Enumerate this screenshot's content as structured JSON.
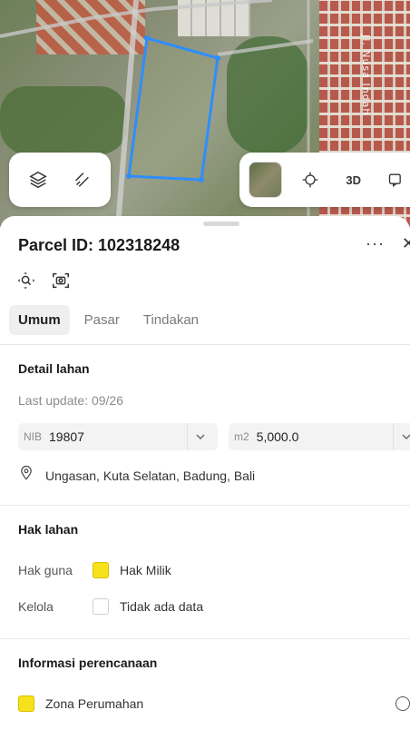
{
  "map": {
    "street_label": "Jl. Nusa Indah",
    "btn_3d_label": "3D",
    "icons": {
      "layers": "layers-icon",
      "draw": "draw-tool-icon",
      "basemap": "basemap-thumbnail",
      "locate": "locate-crosshair-icon",
      "compare": "compare-icon"
    },
    "parcel_color": "#2f8dff"
  },
  "panel": {
    "title": "Parcel ID: 102318248",
    "more": "···",
    "close": "✕",
    "tools": [
      "zoom-to-parcel-icon",
      "screenshot-icon"
    ]
  },
  "tabs": [
    {
      "label": "Umum",
      "active": true
    },
    {
      "label": "Pasar",
      "active": false
    },
    {
      "label": "Tindakan",
      "active": false
    }
  ],
  "detail": {
    "section_title": "Detail lahan",
    "last_update": "Last update: 09/26",
    "nib": {
      "unit": "NIB",
      "value": "19807"
    },
    "area": {
      "unit": "m2",
      "value": "5,000.0"
    },
    "address": "Ungasan, Kuta Selatan, Badung, Bali"
  },
  "hak": {
    "section_title": "Hak lahan",
    "rows": [
      {
        "label": "Hak guna",
        "value": "Hak Milik",
        "color": "#f6e11a"
      },
      {
        "label": "Kelola",
        "value": "Tidak ada data",
        "color": "#ffffff"
      }
    ]
  },
  "planning": {
    "section_title": "Informasi perencanaan",
    "zone": {
      "label": "Zona Perumahan",
      "color": "#f6e11a"
    }
  }
}
